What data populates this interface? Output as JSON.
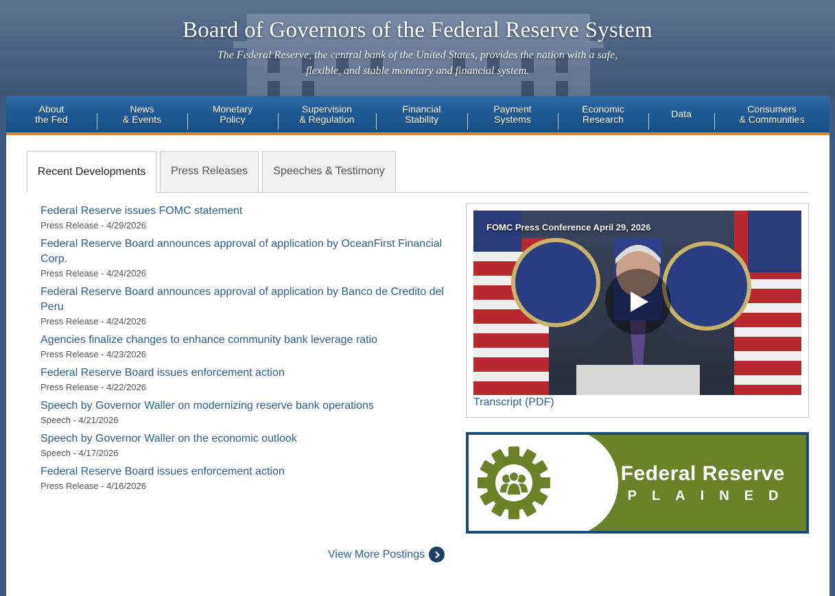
{
  "header": {
    "title": "Board of Governors of the Federal Reserve System",
    "tagline": "The Federal Reserve, the central bank of the United States, provides the nation with a safe, flexible, and stable monetary and financial system."
  },
  "nav": [
    {
      "label": "About\nthe Fed"
    },
    {
      "label": "News\n& Events"
    },
    {
      "label": "Monetary\nPolicy"
    },
    {
      "label": "Supervision\n& Regulation"
    },
    {
      "label": "Financial\nStability"
    },
    {
      "label": "Payment\nSystems"
    },
    {
      "label": "Economic\nResearch"
    },
    {
      "label": "Data"
    },
    {
      "label": "Consumers\n& Communities"
    }
  ],
  "tabs": [
    {
      "label": "Recent Developments",
      "active": true
    },
    {
      "label": "Press Releases",
      "active": false
    },
    {
      "label": "Speeches & Testimony",
      "active": false
    }
  ],
  "news": [
    {
      "title": "Federal Reserve issues FOMC statement",
      "meta": "Press Release - 4/29/2026"
    },
    {
      "title": "Federal Reserve Board announces approval of application by OceanFirst Financial Corp.",
      "meta": "Press Release - 4/24/2026"
    },
    {
      "title": "Federal Reserve Board announces approval of application by Banco de Credito del Peru",
      "meta": "Press Release - 4/24/2026"
    },
    {
      "title": "Agencies finalize changes to enhance community bank leverage ratio",
      "meta": "Press Release - 4/23/2026"
    },
    {
      "title": "Federal Reserve Board issues enforcement action",
      "meta": "Press Release - 4/22/2026"
    },
    {
      "title": "Speech by Governor Waller on modernizing reserve bank operations",
      "meta": "Speech - 4/21/2026"
    },
    {
      "title": "Speech by Governor Waller on the economic outlook",
      "meta": "Speech - 4/17/2026"
    },
    {
      "title": "Federal Reserve Board issues enforcement action",
      "meta": "Press Release - 4/16/2026"
    }
  ],
  "more_label": "View More Postings",
  "video": {
    "title": "FOMC Press Conference April 29, 2026",
    "transcript_label": "Transcript (PDF)"
  },
  "explained": {
    "title": "The Federal Reserve",
    "subtitle": "EXPLAINED"
  },
  "colors": {
    "link": "#2c5f93",
    "nav": "#1f5b97",
    "accent": "#d4882b",
    "explained_green": "#6b8229"
  }
}
